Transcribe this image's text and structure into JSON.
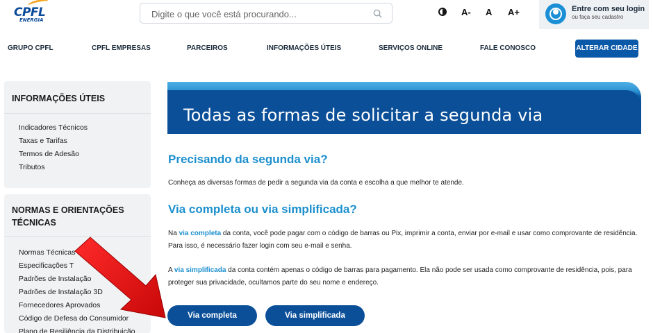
{
  "header": {
    "logo_text": "CPFL",
    "logo_sub": "ENERGIA",
    "search_placeholder": "Digite o que você está procurando...",
    "font_decrease": "A-",
    "font_normal": "A",
    "font_increase": "A+",
    "login_title": "Entre com seu login",
    "login_subtitle": "ou faça seu cadastro"
  },
  "nav": {
    "items": [
      "GRUPO CPFL",
      "CPFL EMPRESAS",
      "PARCEIROS",
      "INFORMAÇÕES ÚTEIS",
      "SERVIÇOS ONLINE",
      "FALE CONOSCO"
    ],
    "city_button": "ALTERAR CIDADE"
  },
  "sidebar": {
    "sections": [
      {
        "title": "INFORMAÇÕES ÚTEIS",
        "items": [
          "Indicadores Técnicos",
          "Taxas e Tarifas",
          "Termos de Adesão",
          "Tributos"
        ]
      },
      {
        "title_line1": "NORMAS E ORIENTAÇÕES",
        "title_line2": "TÉCNICAS",
        "items": [
          "Normas Técnicas",
          "Especificações T",
          "Padrões de Instalação",
          "Padrões de Instalação 3D",
          "Fornecedores Aprovados",
          "Código de Defesa do Consumidor",
          "Plano de Resiliência da Distribuição"
        ]
      }
    ]
  },
  "main": {
    "banner_title": "Todas as formas de solicitar a segunda via",
    "section1_title": "Precisando da segunda via?",
    "section1_text": "Conheça as diversas formas de pedir a segunda via da conta e escolha a que melhor te atende.",
    "section2_title": "Via completa ou via simplificada?",
    "para1_before": "Na ",
    "para1_link": "via completa",
    "para1_after": " da conta, você pode pagar com o código de barras ou Pix, imprimir a conta, enviar por e-mail e usar como comprovante de residência.",
    "para1_line2": "Para isso, é necessário fazer login com seu e-mail e senha.",
    "para2_before": "A ",
    "para2_link": "via simplificada",
    "para2_after": " da conta contém apenas o código de barras para pagamento. Ela não pode ser usada como comprovante de residência, pois, para",
    "para2_line2": "proteger sua privacidade, ocultamos parte do seu nome e endereço.",
    "button_full": "Via completa",
    "button_simple": "Via simplificada"
  },
  "colors": {
    "brand_blue": "#0a4f98",
    "accent_blue": "#1b8fce",
    "arrow_red": "#e01010"
  }
}
